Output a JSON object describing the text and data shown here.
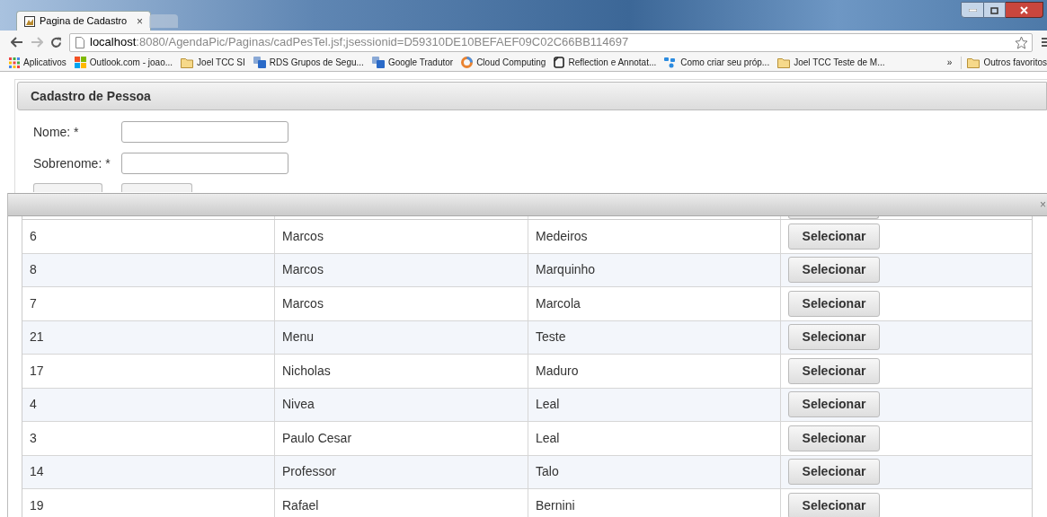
{
  "browser": {
    "tabs": [
      {
        "title": "Pagina de Cadastro",
        "close": "×",
        "selected": true
      },
      {
        "selected": false
      }
    ],
    "address": {
      "host": "localhost",
      "rest": ":8080/AgendaPic/Paginas/cadPesTel.jsf;jsessionid=D59310DE10BEFAEF09C02C66BB114697"
    },
    "bookmarks": [
      {
        "label": "Aplicativos",
        "kind": "apps"
      },
      {
        "label": "Outlook.com - joao...",
        "kind": "windows"
      },
      {
        "label": "Joel TCC SI",
        "kind": "folder"
      },
      {
        "label": "RDS Grupos de Segu...",
        "kind": "translate"
      },
      {
        "label": "Google Tradutor",
        "kind": "translate"
      },
      {
        "label": "Cloud Computing",
        "kind": "ring"
      },
      {
        "label": "Reflection e Annotat...",
        "kind": "page"
      },
      {
        "label": "Como criar seu próp...",
        "kind": "shapes"
      },
      {
        "label": "Joel TCC Teste de M...",
        "kind": "folder"
      }
    ],
    "bookmarks_more": "»",
    "other_bookmarks": "Outros favoritos"
  },
  "panel": {
    "title": "Cadastro de Pessoa",
    "fields": [
      {
        "label": "Nome: *"
      },
      {
        "label": "Sobrenome: *"
      }
    ]
  },
  "dialog": {
    "close": "×",
    "rows": [
      {
        "cells": [
          "6",
          "Marcos",
          "Medeiros"
        ],
        "button": "Selecionar"
      },
      {
        "cells": [
          "8",
          "Marcos",
          "Marquinho"
        ],
        "button": "Selecionar"
      },
      {
        "cells": [
          "7",
          "Marcos",
          "Marcola"
        ],
        "button": "Selecionar"
      },
      {
        "cells": [
          "21",
          "Menu",
          "Teste"
        ],
        "button": "Selecionar"
      },
      {
        "cells": [
          "17",
          "Nicholas",
          "Maduro"
        ],
        "button": "Selecionar"
      },
      {
        "cells": [
          "4",
          "Nivea",
          "Leal"
        ],
        "button": "Selecionar"
      },
      {
        "cells": [
          "3",
          "Paulo Cesar",
          "Leal"
        ],
        "button": "Selecionar"
      },
      {
        "cells": [
          "14",
          "Professor",
          "Talo"
        ],
        "button": "Selecionar"
      },
      {
        "cells": [
          "19",
          "Rafael",
          "Bernini"
        ],
        "button": "Selecionar"
      }
    ]
  }
}
